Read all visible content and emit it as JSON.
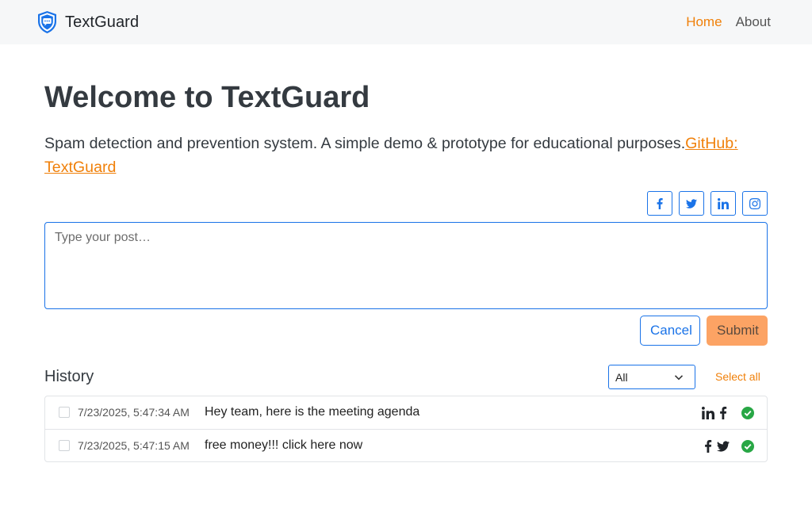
{
  "brand": {
    "name": "TextGuard"
  },
  "nav": {
    "home": "Home",
    "about": "About"
  },
  "main": {
    "title": "Welcome to TextGuard",
    "lead_text": "Spam detection and prevention system. A simple demo & prototype for educational purposes.",
    "lead_link": "GitHub: TextGuard"
  },
  "social": [
    "facebook-icon",
    "twitter-icon",
    "linkedin-icon",
    "instagram-icon"
  ],
  "composer": {
    "placeholder": "Type your post…",
    "value": ""
  },
  "actions": {
    "cancel": "Cancel",
    "submit": "Submit"
  },
  "history": {
    "title": "History",
    "filter_value": "All",
    "select_all": "Select all",
    "items": [
      {
        "timestamp": "7/23/2025, 5:47:34 AM",
        "message": "Hey team, here is the meeting agenda",
        "networks": [
          "linkedin-icon",
          "facebook-icon"
        ],
        "status": "check-circle-icon"
      },
      {
        "timestamp": "7/23/2025, 5:47:15 AM",
        "message": "free money!!! click here now",
        "networks": [
          "facebook-icon",
          "twitter-icon"
        ],
        "status": "check-circle-icon"
      }
    ]
  },
  "colors": {
    "accent": "#f0800a",
    "primary": "#1a73e8",
    "submit_bg": "#fca364",
    "success": "#28a745"
  }
}
